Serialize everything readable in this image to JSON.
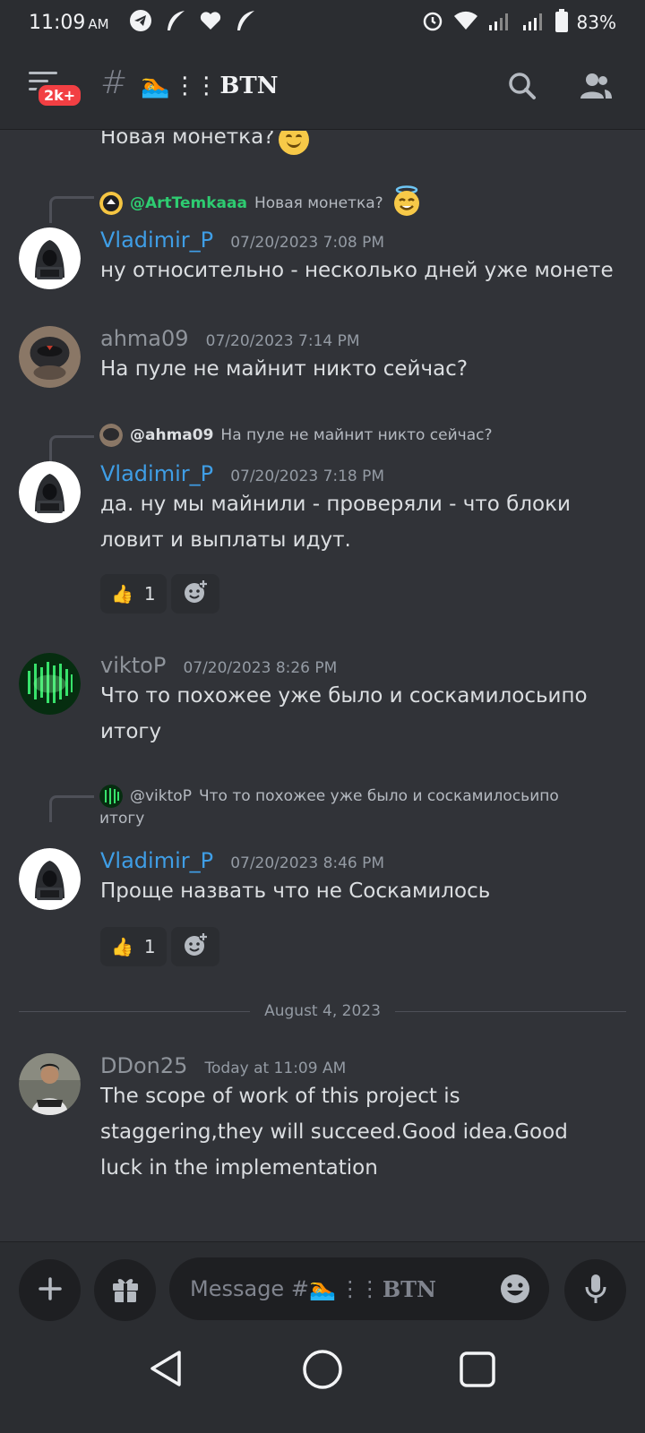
{
  "status_bar": {
    "time": "11:09",
    "ampm": "AM",
    "battery": "83%"
  },
  "header": {
    "unread_badge": "2k+",
    "channel_hash": "#",
    "channel_name": "BTN",
    "channel_emoji": "🏊",
    "channel_dots": "⋮⋮"
  },
  "messages": [
    {
      "text": "Новая монетка?",
      "emoji": "smile"
    },
    {
      "reply_to": {
        "name": "@ArtTemkaaa",
        "text": "Новая монетка?"
      },
      "author": "Vladimir_P",
      "timestamp": "07/20/2023 7:08 PM",
      "text": "ну относительно - несколько дней уже монете"
    },
    {
      "author": "ahma09",
      "timestamp": "07/20/2023 7:14 PM",
      "text": "На пуле не майнит никто сейчас?"
    },
    {
      "reply_to": {
        "name": "@ahma09",
        "text": "На пуле не майнит никто сейчас?"
      },
      "author": "Vladimir_P",
      "timestamp": "07/20/2023 7:18 PM",
      "text_line1": "да. ну мы майнили - проверяли - что блоки",
      "text_line2": "ловит и выплаты идут.",
      "reaction": {
        "emoji": "👍",
        "count": "1"
      }
    },
    {
      "author": "viktoP",
      "timestamp": "07/20/2023 8:26 PM",
      "text_line1": "Что то похожее уже было и соскамилосьипо",
      "text_line2": "итогу"
    },
    {
      "reply_to": {
        "name": "@viktoP",
        "text_line1": "Что то похожее уже было и соскамилосьипо",
        "text_line2": "итогу"
      },
      "author": "Vladimir_P",
      "timestamp": "07/20/2023 8:46 PM",
      "text": "Проще назвать что не Соскамилось",
      "reaction": {
        "emoji": "👍",
        "count": "1"
      }
    },
    {
      "author": "DDon25",
      "timestamp": "Today at 11:09 AM",
      "text_line1": "The scope of work of this project is",
      "text_line2": "staggering,they will succeed.Good idea.Good",
      "text_line3": "luck in the implementation"
    }
  ],
  "date_divider": "August 4, 2023",
  "composer": {
    "placeholder_prefix": "Message #",
    "placeholder_suffix": "BTN"
  },
  "colors": {
    "background": "#313338",
    "header": "#2b2d31",
    "link_blue": "#3f9ee6",
    "reply_green": "#2ecc71",
    "badge_red": "#f23f43"
  },
  "icons": [
    "telegram-icon",
    "feather-icon",
    "heart-icon",
    "alarm-icon",
    "wifi-icon",
    "signal-icon",
    "battery-icon",
    "menu-icon",
    "search-icon",
    "members-icon",
    "plus-icon",
    "gift-icon",
    "emoji-icon",
    "mic-icon",
    "back-icon",
    "home-icon",
    "recents-icon",
    "add-reaction-icon"
  ]
}
